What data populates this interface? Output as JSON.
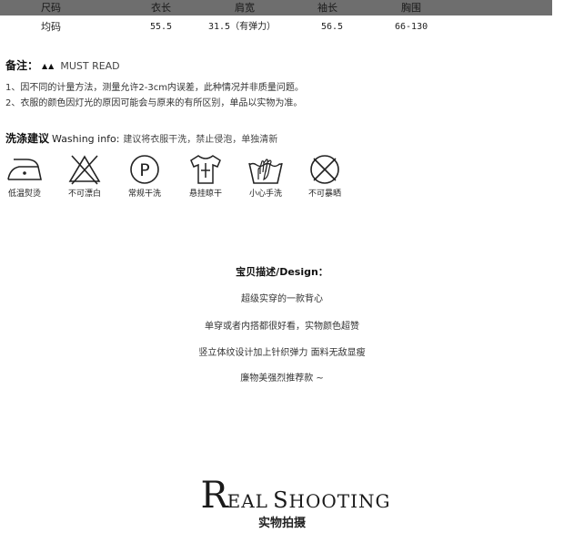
{
  "size_table": {
    "headers": [
      "尺码",
      "衣长",
      "肩宽",
      "袖长",
      "胸围"
    ],
    "row": [
      "均码",
      "55.5",
      "31.5（有弹力）",
      "56.5",
      "66-130"
    ]
  },
  "notes": {
    "title": "备注：",
    "symbols": "▲▲",
    "must_read": "MUST READ",
    "lines": [
      "1、因不同的计量方法，测量允许2-3cm内误差，此种情况并非质量问题。",
      "2、衣服的颜色因灯光的原因可能会与原来的有所区别，单品以实物为准。"
    ]
  },
  "washing": {
    "title": "洗涤建议",
    "title_en": "Washing info:",
    "text": "建议将衣服干洗，禁止侵泡，单独清新",
    "items": [
      {
        "label": "低温熨烫",
        "icon": "low-temp-iron-icon"
      },
      {
        "label": "不可漂白",
        "icon": "no-bleach-icon"
      },
      {
        "label": "常规干洗",
        "icon": "dry-clean-p-icon"
      },
      {
        "label": "悬挂晾干",
        "icon": "hang-dry-icon"
      },
      {
        "label": "小心手洗",
        "icon": "hand-wash-icon"
      },
      {
        "label": "不可暴晒",
        "icon": "no-tumble-dry-icon"
      }
    ]
  },
  "design": {
    "title": "宝贝描述/Design：",
    "lines": [
      "超级实穿的一款背心",
      "单穿或者内搭都很好看，实物颜色超赞",
      "竖立体纹设计加上针织弹力 面料无敌显瘦",
      "廉物美强烈推荐款 ~"
    ]
  },
  "real_shooting": {
    "title_big_1": "R",
    "title_small_1": "EAL",
    "title_big_2": "S",
    "title_small_2": "HOOTING",
    "subtitle": "实物拍摄"
  }
}
